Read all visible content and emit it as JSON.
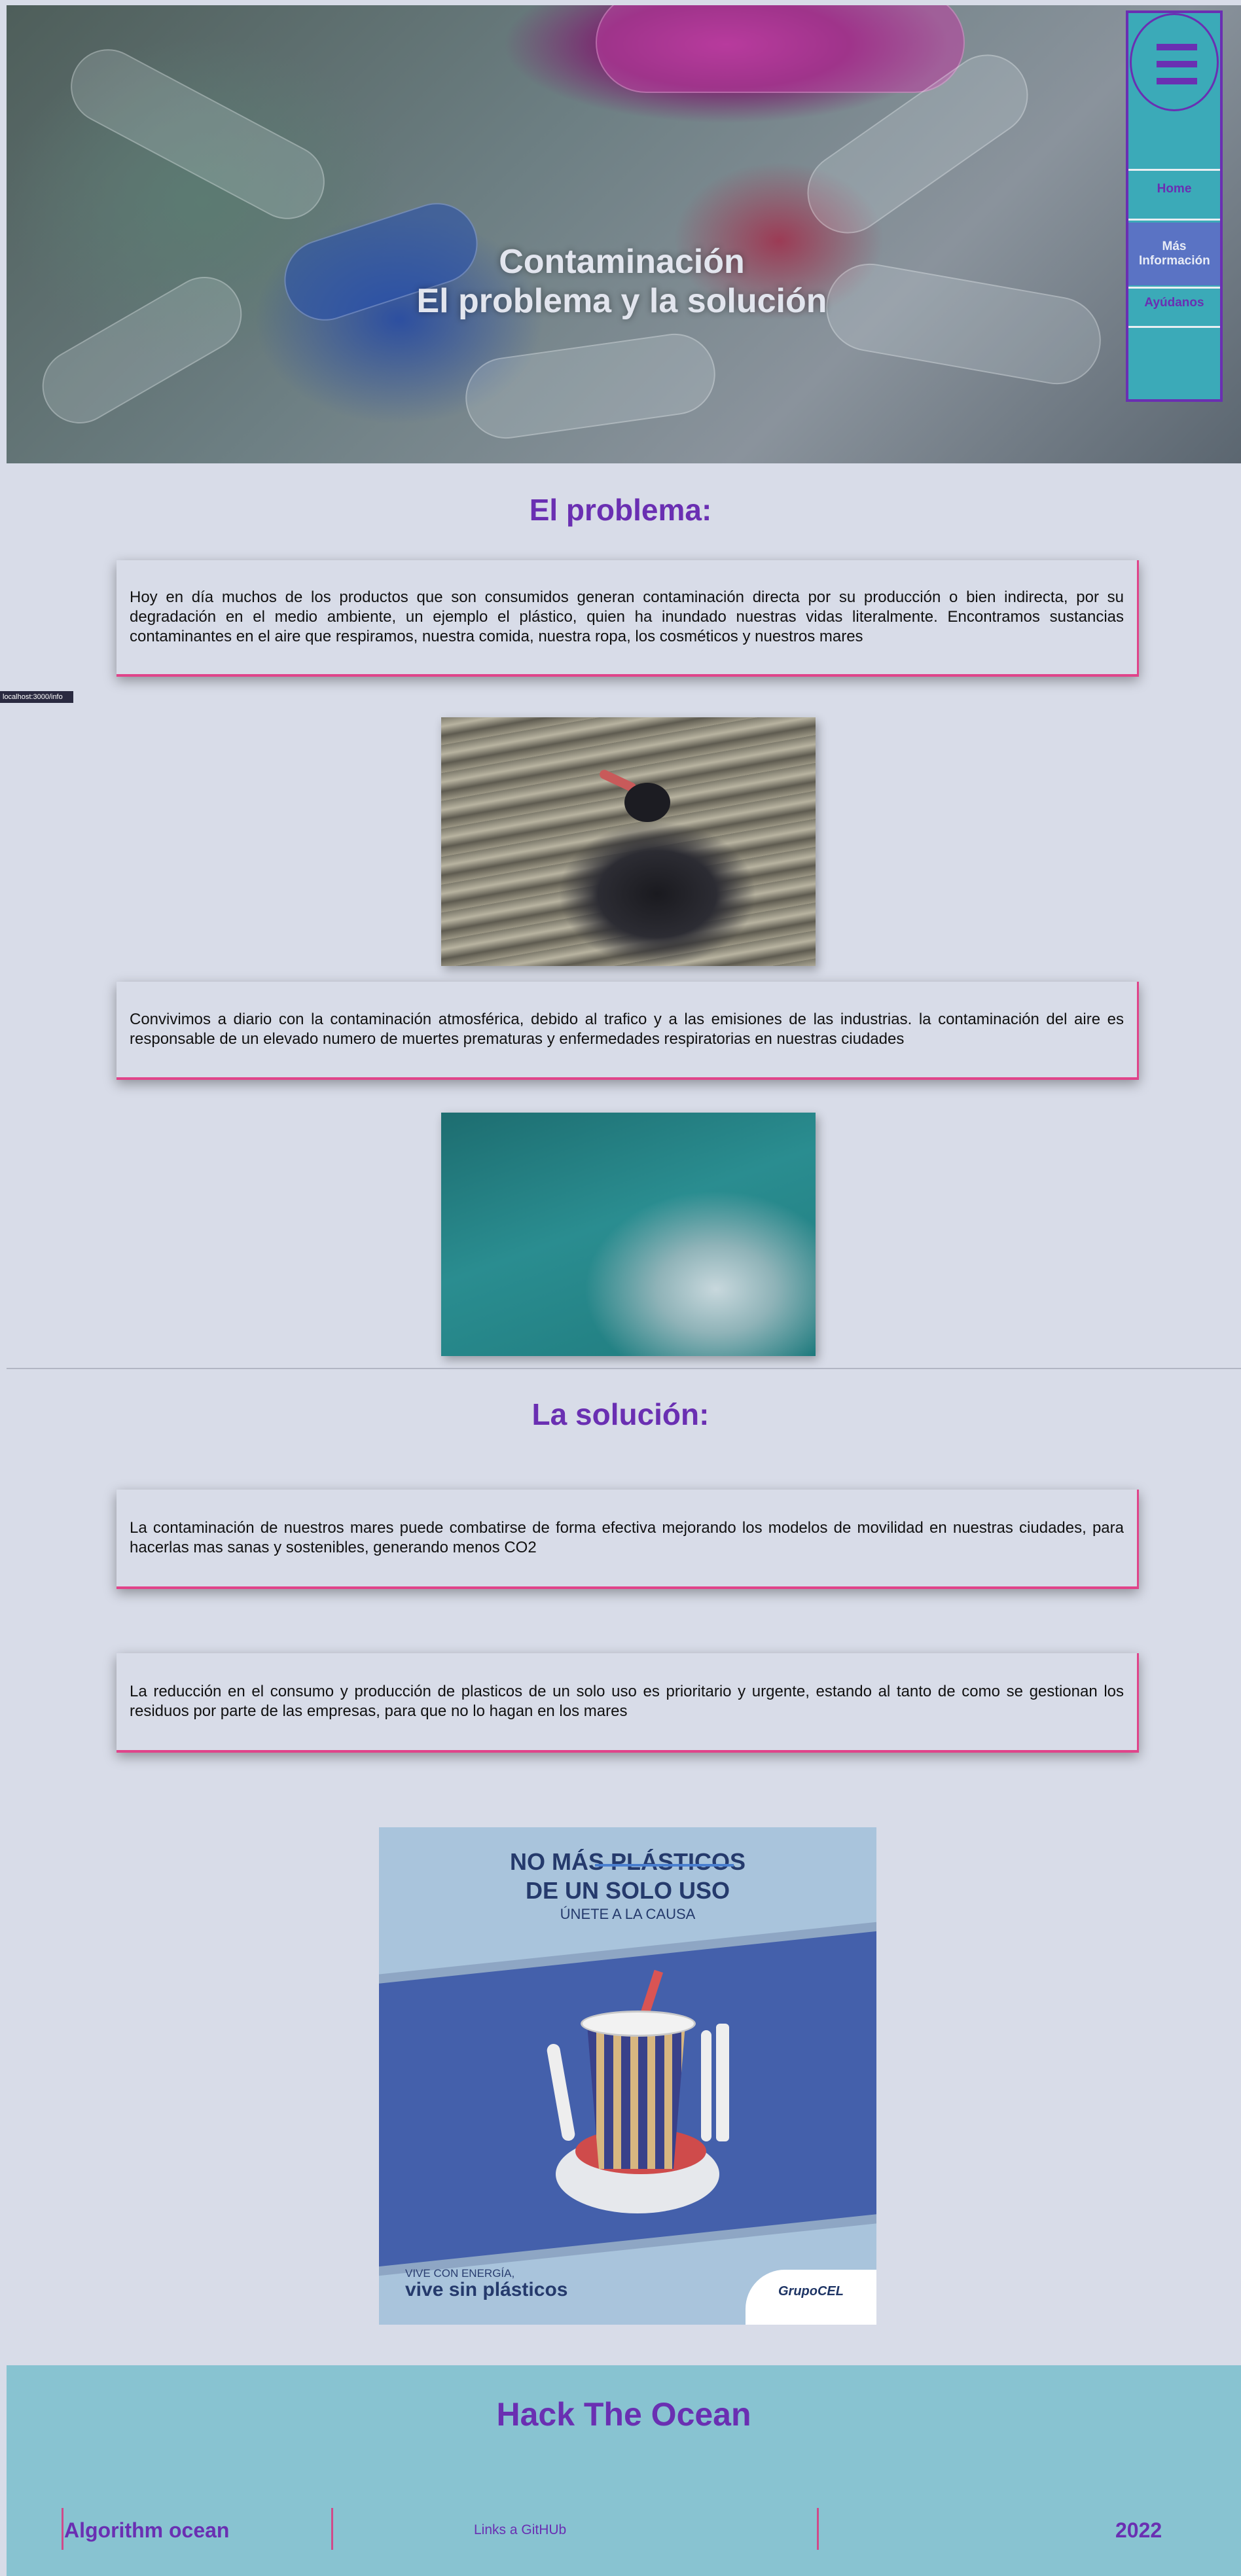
{
  "hero": {
    "title_line1": "Contaminación",
    "title_line2": "El problema y la solución"
  },
  "nav": {
    "menu_icon": "hamburger-icon",
    "items": [
      {
        "label": "Home"
      },
      {
        "label": "Más Información"
      },
      {
        "label": "Ayúdanos"
      }
    ]
  },
  "status_url": "localhost:3000/info",
  "problem": {
    "heading": "El problema:",
    "card1": "Hoy en día muchos de los productos que son consumidos generan contaminación directa por su producción o bien indirecta, por su degradación en el medio ambiente, un ejemplo el plástico, quien ha inundado nuestras vidas literalmente. Encontramos sustancias contaminantes en el aire que respiramos, nuestra comida, nuestra ropa, los cosméticos y nuestros mares",
    "card2": "Convivimos a diario con la contaminación atmosférica, debido al trafico y a las emisiones de las industrias. la contaminación del aire es responsable de un elevado numero de muertes prematuras y enfermedades respiratorias en nuestras ciudades"
  },
  "solution": {
    "heading": "La solución:",
    "card1": "La contaminación de nuestros mares puede combatirse de forma efectiva mejorando los modelos de movilidad en nuestras ciudades, para hacerlas mas sanas y sostenibles, generando menos CO2",
    "card2": "La reducción en el consumo y producción de plasticos de un solo uso es prioritario y urgente, estando al tanto de como se gestionan los residuos por parte de las empresas, para que no lo hagan en los mares"
  },
  "poster": {
    "line1": "NO MÁS PLÁSTICOS",
    "line2": "DE UN SOLO USO",
    "line3": "ÚNETE A LA CAUSA",
    "tagline_small": "VIVE CON ENERGÍA,",
    "tagline_big": "vive sin plásticos",
    "brand": "GrupoCEL"
  },
  "footer": {
    "title": "Hack The Ocean",
    "team": "Algorithm ocean",
    "links": "Links a GitHUb",
    "year": "2022"
  },
  "colors": {
    "accent": "#6a2fb2",
    "pink": "#e0448a",
    "nav_bg": "#3baab8",
    "footer_bg": "#88c3d1",
    "page_bg": "#d8dce8"
  }
}
